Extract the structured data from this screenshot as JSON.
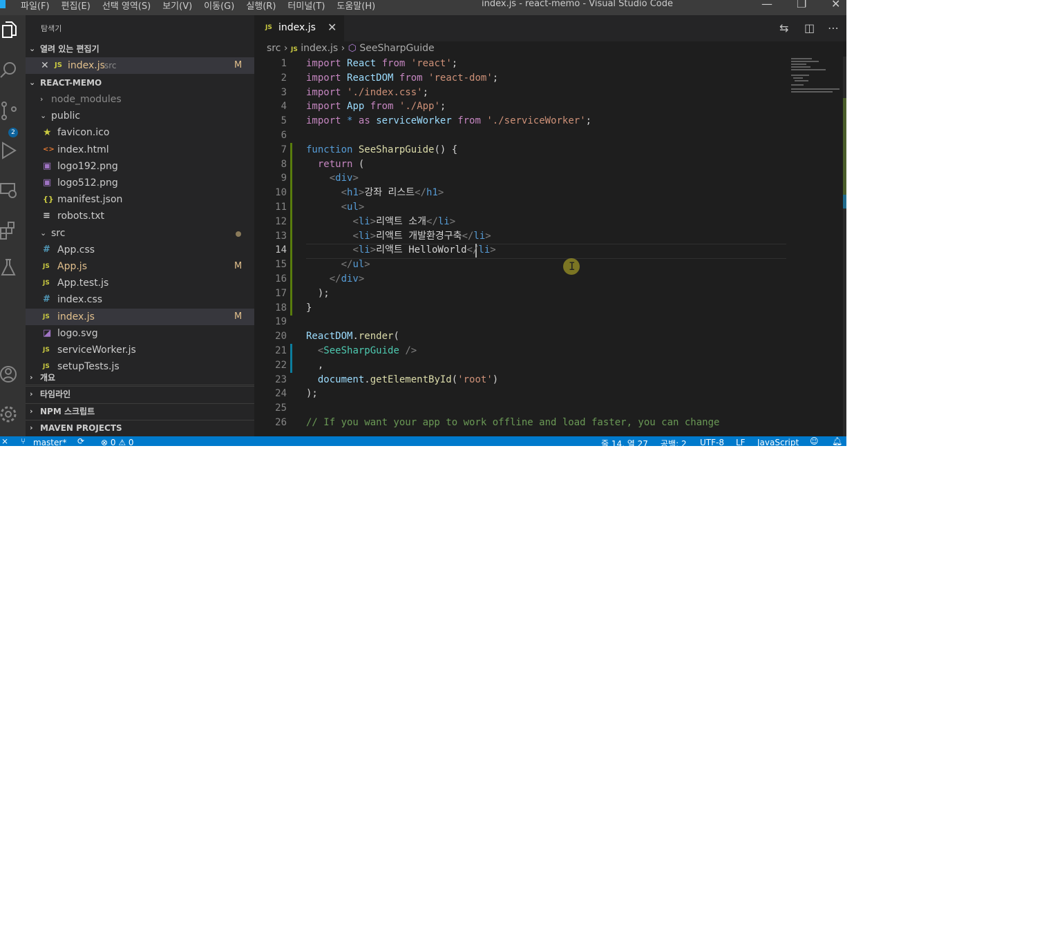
{
  "window": {
    "title": "index.js - react-memo - Visual Studio Code",
    "menu": [
      "파일(F)",
      "편집(E)",
      "선택 영역(S)",
      "보기(V)",
      "이동(G)",
      "실행(R)",
      "터미널(T)",
      "도움말(H)"
    ]
  },
  "activity_bar": {
    "items": [
      "explorer-icon",
      "search-icon",
      "source-control-icon",
      "run-debug-icon",
      "remote-explorer-icon",
      "extensions-icon",
      "testing-icon",
      "account-icon",
      "settings-gear-icon"
    ],
    "scm_badge": "2"
  },
  "sidebar": {
    "title": "탐색기",
    "open_editors_header": "열려 있는 편집기",
    "open_editor": {
      "name": "index.js",
      "folder": "src",
      "badge": "M"
    },
    "project_header": "REACT-MEMO",
    "tree": [
      {
        "name": "node_modules",
        "type": "folder",
        "open": false
      },
      {
        "name": "public",
        "type": "folder",
        "open": true
      },
      {
        "name": "favicon.ico",
        "type": "file",
        "icon": "star-icon"
      },
      {
        "name": "index.html",
        "type": "file",
        "icon": "html-icon"
      },
      {
        "name": "logo192.png",
        "type": "file",
        "icon": "image-icon"
      },
      {
        "name": "logo512.png",
        "type": "file",
        "icon": "image-icon"
      },
      {
        "name": "manifest.json",
        "type": "file",
        "icon": "json-icon"
      },
      {
        "name": "robots.txt",
        "type": "file",
        "icon": "text-icon"
      },
      {
        "name": "src",
        "type": "folder",
        "open": true
      },
      {
        "name": "App.css",
        "type": "file",
        "icon": "css-icon"
      },
      {
        "name": "App.js",
        "type": "file",
        "icon": "js-icon",
        "badge": "M"
      },
      {
        "name": "App.test.js",
        "type": "file",
        "icon": "js-icon"
      },
      {
        "name": "index.css",
        "type": "file",
        "icon": "css-icon"
      },
      {
        "name": "index.js",
        "type": "file",
        "icon": "js-icon",
        "badge": "M",
        "selected": true
      },
      {
        "name": "logo.svg",
        "type": "file",
        "icon": "svg-icon"
      },
      {
        "name": "serviceWorker.js",
        "type": "file",
        "icon": "js-icon"
      },
      {
        "name": "setupTests.js",
        "type": "file",
        "icon": "js-icon"
      }
    ],
    "sections": [
      "개요",
      "타임라인",
      "NPM 스크립트",
      "MAVEN PROJECTS"
    ]
  },
  "editor": {
    "tab": {
      "label": "index.js",
      "icon_text": "JS"
    },
    "breadcrumb": [
      "src",
      "index.js",
      "SeeSharpGuide"
    ],
    "current_line": 14,
    "lines": [
      [
        [
          "kw",
          "import"
        ],
        [
          "p",
          " "
        ],
        [
          "var",
          "React"
        ],
        [
          "p",
          " "
        ],
        [
          "kw",
          "from"
        ],
        [
          "p",
          " "
        ],
        [
          "str",
          "'react'"
        ],
        [
          "p",
          ";"
        ]
      ],
      [
        [
          "kw",
          "import"
        ],
        [
          "p",
          " "
        ],
        [
          "var",
          "ReactDOM"
        ],
        [
          "p",
          " "
        ],
        [
          "kw",
          "from"
        ],
        [
          "p",
          " "
        ],
        [
          "str",
          "'react-dom'"
        ],
        [
          "p",
          ";"
        ]
      ],
      [
        [
          "kw",
          "import"
        ],
        [
          "p",
          " "
        ],
        [
          "str",
          "'./index.css'"
        ],
        [
          "p",
          ";"
        ]
      ],
      [
        [
          "kw",
          "import"
        ],
        [
          "p",
          " "
        ],
        [
          "var",
          "App"
        ],
        [
          "p",
          " "
        ],
        [
          "kw",
          "from"
        ],
        [
          "p",
          " "
        ],
        [
          "str",
          "'./App'"
        ],
        [
          "p",
          ";"
        ]
      ],
      [
        [
          "kw",
          "import"
        ],
        [
          "p",
          " "
        ],
        [
          "key",
          "*"
        ],
        [
          "p",
          " "
        ],
        [
          "kw",
          "as"
        ],
        [
          "p",
          " "
        ],
        [
          "var",
          "serviceWorker"
        ],
        [
          "p",
          " "
        ],
        [
          "kw",
          "from"
        ],
        [
          "p",
          " "
        ],
        [
          "str",
          "'./serviceWorker'"
        ],
        [
          "p",
          ";"
        ]
      ],
      [],
      [
        [
          "key",
          "function"
        ],
        [
          "p",
          " "
        ],
        [
          "fn",
          "SeeSharpGuide"
        ],
        [
          "p",
          "() {"
        ]
      ],
      [
        [
          "p",
          "  "
        ],
        [
          "kw",
          "return"
        ],
        [
          "p",
          " ("
        ]
      ],
      [
        [
          "p",
          "    "
        ],
        [
          "tagb",
          "<"
        ],
        [
          "tag",
          "div"
        ],
        [
          "tagb",
          ">"
        ]
      ],
      [
        [
          "p",
          "      "
        ],
        [
          "tagb",
          "<"
        ],
        [
          "tag",
          "h1"
        ],
        [
          "tagb",
          ">"
        ],
        [
          "p",
          "강좌 리스트"
        ],
        [
          "tagb",
          "</"
        ],
        [
          "tag",
          "h1"
        ],
        [
          "tagb",
          ">"
        ]
      ],
      [
        [
          "p",
          "      "
        ],
        [
          "tagb",
          "<"
        ],
        [
          "tag",
          "ul"
        ],
        [
          "tagb",
          ">"
        ]
      ],
      [
        [
          "p",
          "        "
        ],
        [
          "tagb",
          "<"
        ],
        [
          "tag",
          "li"
        ],
        [
          "tagb",
          ">"
        ],
        [
          "p",
          "리액트 소개"
        ],
        [
          "tagb",
          "</"
        ],
        [
          "tag",
          "li"
        ],
        [
          "tagb",
          ">"
        ]
      ],
      [
        [
          "p",
          "        "
        ],
        [
          "tagb",
          "<"
        ],
        [
          "tag",
          "li"
        ],
        [
          "tagb",
          ">"
        ],
        [
          "p",
          "리액트 개발환경구축"
        ],
        [
          "tagb",
          "</"
        ],
        [
          "tag",
          "li"
        ],
        [
          "tagb",
          ">"
        ]
      ],
      [
        [
          "p",
          "        "
        ],
        [
          "tagb",
          "<"
        ],
        [
          "tag",
          "li"
        ],
        [
          "tagb",
          ">"
        ],
        [
          "p",
          "리액트 HelloWorld"
        ],
        [
          "tagb",
          "</"
        ],
        [
          "tag",
          "li"
        ],
        [
          "tagb",
          ">"
        ]
      ],
      [
        [
          "p",
          "      "
        ],
        [
          "tagb",
          "</"
        ],
        [
          "tag",
          "ul"
        ],
        [
          "tagb",
          ">"
        ]
      ],
      [
        [
          "p",
          "    "
        ],
        [
          "tagb",
          "</"
        ],
        [
          "tag",
          "div"
        ],
        [
          "tagb",
          ">"
        ]
      ],
      [
        [
          "p",
          "  );"
        ]
      ],
      [
        [
          "p",
          "}"
        ]
      ],
      [],
      [
        [
          "var",
          "ReactDOM"
        ],
        [
          "p",
          "."
        ],
        [
          "fn",
          "render"
        ],
        [
          "p",
          "("
        ]
      ],
      [
        [
          "p",
          "  "
        ],
        [
          "tagb",
          "<"
        ],
        [
          "cls",
          "SeeSharpGuide"
        ],
        [
          "p",
          " "
        ],
        [
          "tagb",
          "/>"
        ]
      ],
      [
        [
          "p",
          "  ,"
        ]
      ],
      [
        [
          "p",
          "  "
        ],
        [
          "var",
          "document"
        ],
        [
          "p",
          "."
        ],
        [
          "fn",
          "getElementById"
        ],
        [
          "p",
          "("
        ],
        [
          "str",
          "'root'"
        ],
        [
          "p",
          ")"
        ]
      ],
      [
        [
          "p",
          ");"
        ]
      ],
      [],
      [
        [
          "cmt",
          "// If you want your app to work offline and load faster, you can change"
        ]
      ]
    ]
  },
  "status_bar": {
    "branch": "master*",
    "problems": "⊗ 0 ⚠ 0",
    "position": "줄 14, 열 27",
    "indent": "공백: 2",
    "encoding": "UTF-8",
    "eol": "LF",
    "language": "JavaScript"
  },
  "colors": {
    "accent": "#007acc",
    "modified": "#e2c08d",
    "js_icon": "#cbcb41"
  }
}
